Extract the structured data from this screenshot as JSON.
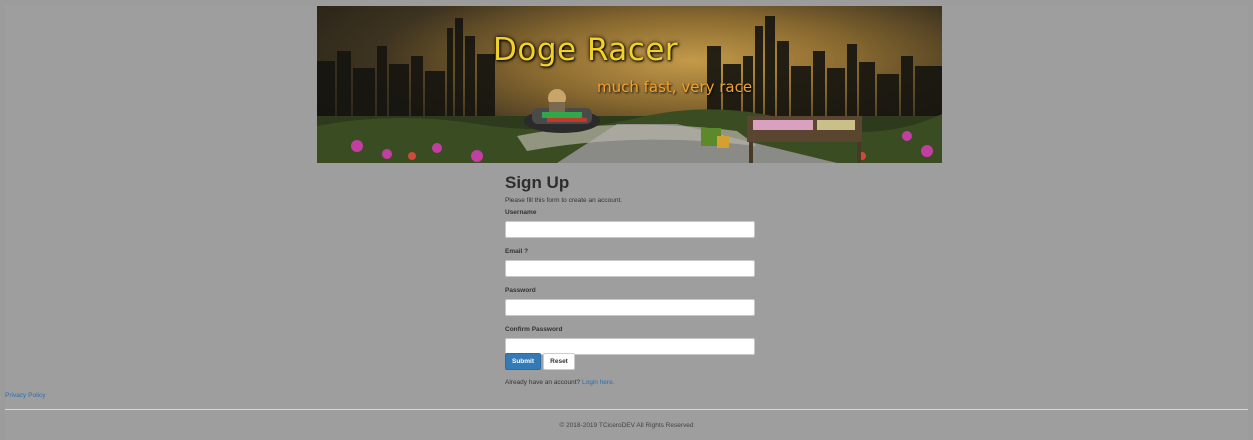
{
  "banner": {
    "title": "Doge Racer",
    "subtitle": "much fast, very race"
  },
  "form": {
    "title": "Sign Up",
    "description": "Please fill this form to create an account.",
    "fields": [
      {
        "label": "Username",
        "value": ""
      },
      {
        "label": "Email ?",
        "value": ""
      },
      {
        "label": "Password",
        "value": ""
      },
      {
        "label": "Confirm Password",
        "value": ""
      }
    ],
    "submit_label": "Submit",
    "reset_label": "Reset",
    "login_prompt": "Already have an account?",
    "login_link": "Login here."
  },
  "privacy_link": "Privacy Policy",
  "footer": {
    "copyright": "© 2018-2019 TCiceroDEV All Rights Reserved"
  },
  "colors": {
    "background": "#9c9c9c",
    "title_yellow": "#f2d22a",
    "subtitle_orange": "#f4a12a",
    "submit_blue": "#337ab7",
    "link_blue": "#2a6fb0"
  }
}
